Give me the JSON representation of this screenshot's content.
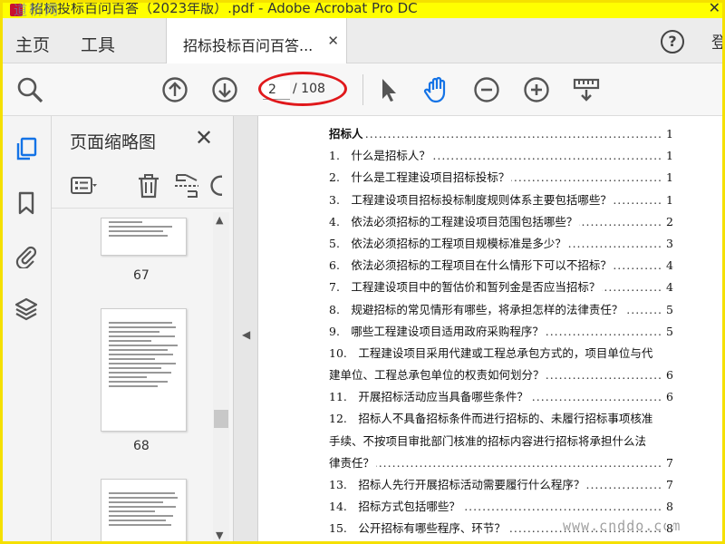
{
  "window": {
    "title": "招标投标百问百答（2023年版）.pdf - Adobe Acrobat Pro DC",
    "watermark_top": "道桥网"
  },
  "tabs": {
    "home": "主页",
    "tools": "工具",
    "document": "招标投标百问百答...",
    "sign_in": "登"
  },
  "toolbar": {
    "current_page": "2",
    "total_pages": "/ 108"
  },
  "thumbnails": {
    "title": "页面缩略图",
    "pages": [
      {
        "label": "67"
      },
      {
        "label": "68"
      }
    ]
  },
  "toc": {
    "rows": [
      {
        "text": "招标人",
        "page": "1",
        "head": true
      },
      {
        "text": "1.　什么是招标人？",
        "page": "1"
      },
      {
        "text": "2.　什么是工程建设项目招标投标？",
        "page": "1"
      },
      {
        "text": "3.　工程建设项目招标投标制度规则体系主要包括哪些？",
        "page": "1"
      },
      {
        "text": "4.　依法必须招标的工程建设项目范围包括哪些？",
        "page": "2"
      },
      {
        "text": "5.　依法必须招标的工程项目规模标准是多少？",
        "page": "3"
      },
      {
        "text": "6.　依法必须招标的工程项目在什么情形下可以不招标？",
        "page": "4"
      },
      {
        "text": "7.　工程建设项目中的暂估价和暂列金是否应当招标？",
        "page": "4"
      },
      {
        "text": "8.　规避招标的常见情形有哪些，将承担怎样的法律责任？",
        "page": "5"
      },
      {
        "text": "9.　哪些工程建设项目适用政府采购程序？",
        "page": "5"
      },
      {
        "text": "10.　工程建设项目采用代建或工程总承包方式的，项目单位与代",
        "page": "",
        "nodots": true
      },
      {
        "text": "建单位、工程总承包单位的权责如何划分？",
        "page": "6",
        "cont": true
      },
      {
        "text": "11.　开展招标活动应当具备哪些条件？",
        "page": "6"
      },
      {
        "text": "12.　招标人不具备招标条件而进行招标的、未履行招标事项核准",
        "page": "",
        "nodots": true
      },
      {
        "text": "手续、不按项目审批部门核准的招标内容进行招标将承担什么法",
        "page": "",
        "nodots": true,
        "cont": true
      },
      {
        "text": "律责任？",
        "page": "7",
        "cont": true
      },
      {
        "text": "13.　招标人先行开展招标活动需要履行什么程序？",
        "page": "7"
      },
      {
        "text": "14.　招标方式包括哪些？",
        "page": "8"
      },
      {
        "text": "15.　公开招标有哪些程序、环节？",
        "page": "8"
      }
    ]
  },
  "watermark": "www.cnddo.com"
}
